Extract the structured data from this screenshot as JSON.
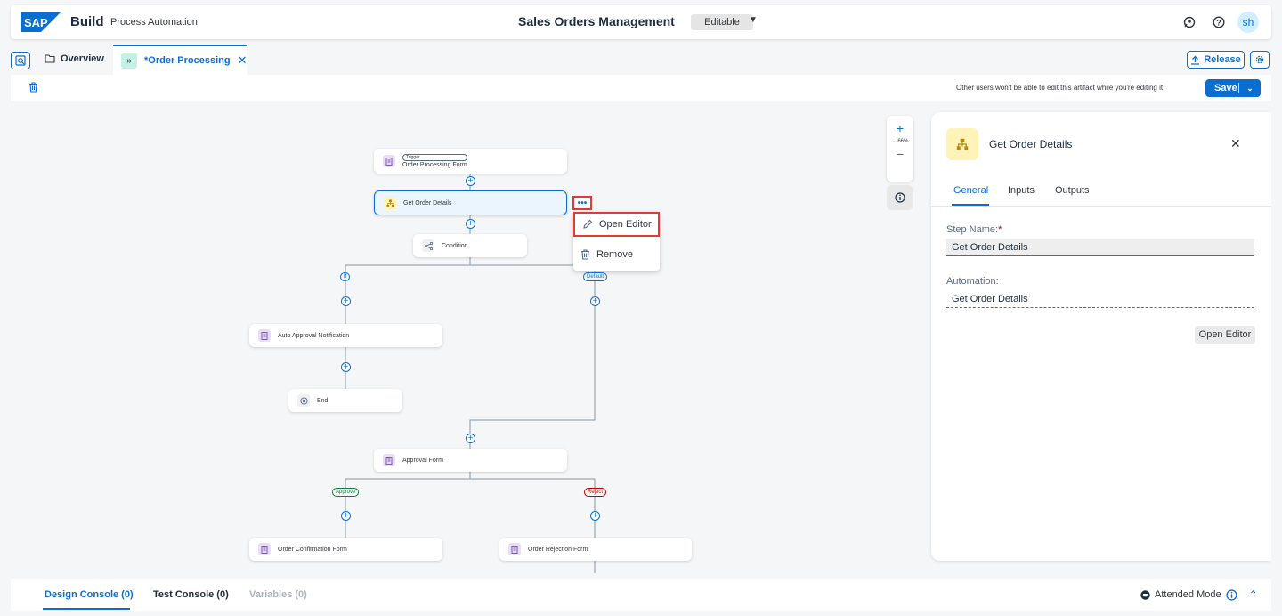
{
  "header": {
    "logo_text": "SAP",
    "product": "Build",
    "subproduct": "Process Automation",
    "project_title": "Sales Orders Management",
    "mode": "Editable",
    "avatar": "sh"
  },
  "tabs": {
    "overview": "Overview",
    "active": "*Order Processing",
    "release": "Release"
  },
  "toolbar": {
    "lock_message": "Other users won't be able to edit this artifact while you're editing it.",
    "save": "Save"
  },
  "canvas": {
    "zoom": "66%",
    "nodes": {
      "trigger_badge": "Trigger",
      "trigger": "Order Processing Form",
      "get_order": "Get Order Details",
      "condition": "Condition",
      "auto_approval": "Auto Approval Notification",
      "end": "End",
      "approval_form": "Approval Form",
      "confirmation": "Order Confirmation Form",
      "rejection": "Order Rejection Form"
    },
    "branches": {
      "if": "If",
      "default": "Default",
      "approve": "Approve",
      "reject": "Reject"
    },
    "context_menu": {
      "open_editor": "Open Editor",
      "remove": "Remove"
    }
  },
  "panel": {
    "title": "Get Order Details",
    "tabs": [
      "General",
      "Inputs",
      "Outputs"
    ],
    "step_name_label": "Step Name:",
    "step_name_required": "*",
    "step_name_value": "Get Order Details",
    "automation_label": "Automation:",
    "automation_value": "Get Order Details",
    "open_editor": "Open Editor"
  },
  "console": {
    "design": "Design Console (0)",
    "test": "Test Console (0)",
    "variables": "Variables (0)",
    "attended": "Attended Mode"
  },
  "colors": {
    "accent": "#0a6ed1",
    "highlight": "#e53935",
    "approve": "#107e3e",
    "reject": "#bb0000"
  }
}
